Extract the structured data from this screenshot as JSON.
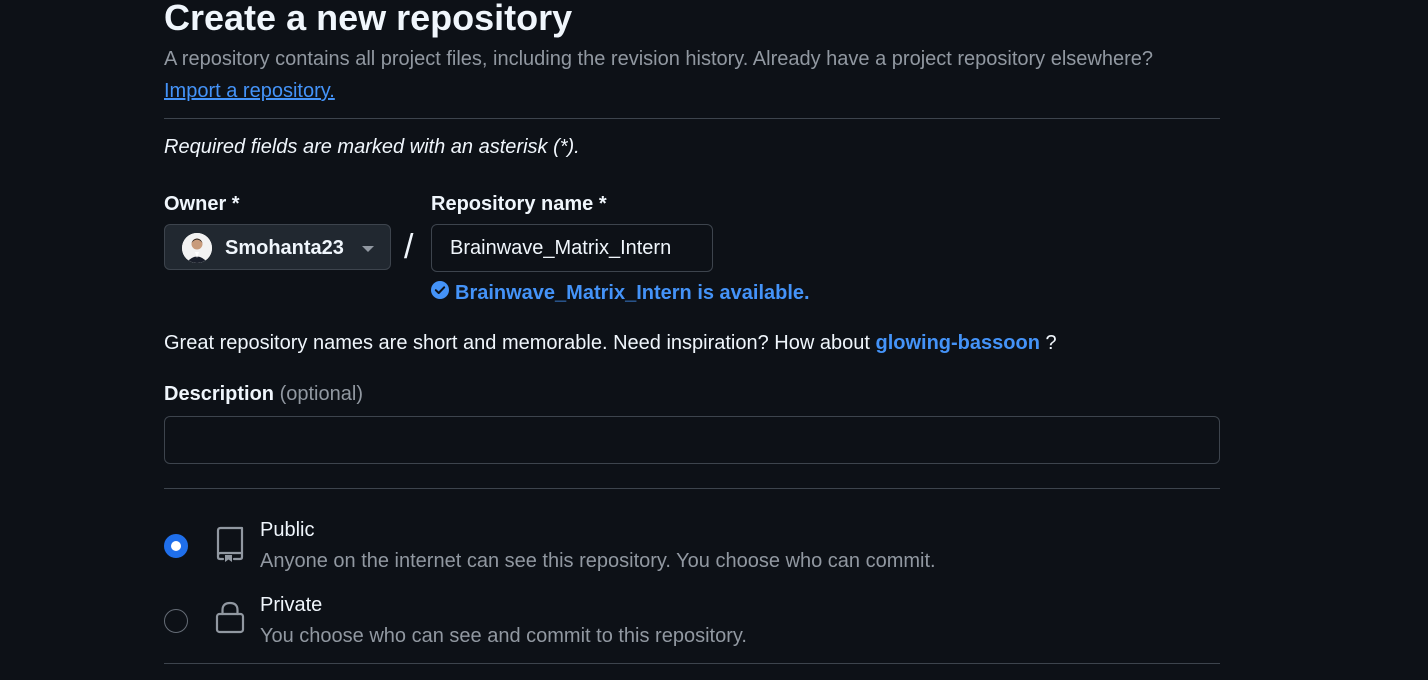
{
  "page": {
    "title": "Create a new repository",
    "subtitle": "A repository contains all project files, including the revision history. Already have a project repository elsewhere?",
    "import_link": "Import a repository.",
    "required_note": "Required fields are marked with an asterisk (*)."
  },
  "owner": {
    "label": "Owner *",
    "value": "Smohanta23"
  },
  "separator": "/",
  "repo_name": {
    "label": "Repository name *",
    "value": "Brainwave_Matrix_Intern",
    "availability": "Brainwave_Matrix_Intern is available."
  },
  "suggestion": {
    "prefix": "Great repository names are short and memorable. Need inspiration? How about",
    "name": "glowing-bassoon",
    "suffix": "?"
  },
  "description": {
    "label": "Description",
    "optional": "(optional)",
    "value": "",
    "placeholder": ""
  },
  "visibility": {
    "options": [
      {
        "label": "Public",
        "description": "Anyone on the internet can see this repository. You choose who can commit.",
        "icon": "repo-icon",
        "selected": true
      },
      {
        "label": "Private",
        "description": "You choose who can see and commit to this repository.",
        "icon": "lock-icon",
        "selected": false
      }
    ]
  },
  "colors": {
    "background": "#0d1117",
    "link": "#4493f8",
    "accent": "#1f6feb",
    "border": "#3d444d",
    "muted_text": "#9198a1"
  }
}
